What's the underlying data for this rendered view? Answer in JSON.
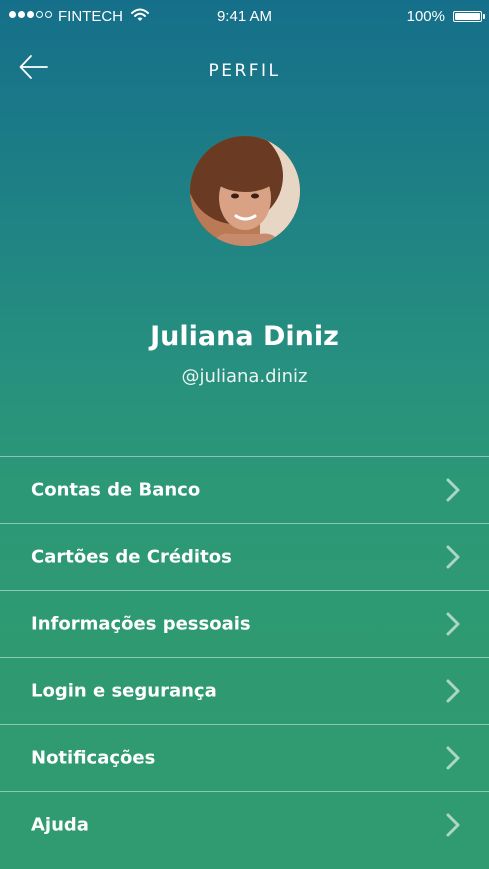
{
  "status_bar": {
    "carrier": "FINTECH",
    "time": "9:41 AM",
    "battery": "100%"
  },
  "nav": {
    "title": "PERFIL"
  },
  "profile": {
    "name": "Juliana Diniz",
    "handle": "@juliana.diniz"
  },
  "menu": {
    "items": [
      {
        "label": "Contas de Banco"
      },
      {
        "label": "Cartões de Créditos"
      },
      {
        "label": "Informações pessoais"
      },
      {
        "label": "Login e segurança"
      },
      {
        "label": "Notificações"
      },
      {
        "label": "Ajuda"
      }
    ]
  },
  "colors": {
    "gradient_top": "#156f8a",
    "gradient_bottom": "#309b70",
    "text": "#ffffff"
  }
}
